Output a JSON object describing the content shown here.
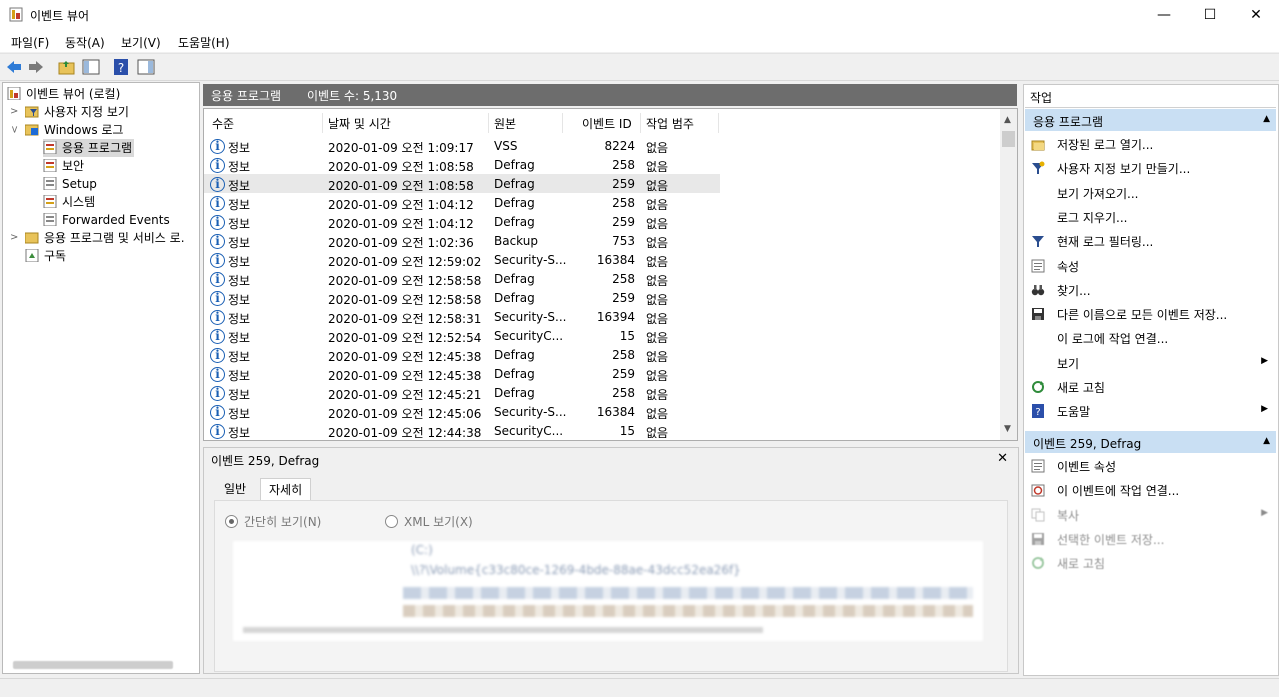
{
  "window": {
    "title": "이벤트 뷰어",
    "minimize": "—",
    "maximize": "☐",
    "close": "✕"
  },
  "menu": [
    "파일(F)",
    "동작(A)",
    "보기(V)",
    "도움말(H)"
  ],
  "tree": {
    "root": "이벤트 뷰어 (로컬)",
    "custom_views": "사용자 지정 보기",
    "windows_logs": "Windows 로그",
    "app_log": "응용 프로그램",
    "security": "보안",
    "setup": "Setup",
    "system": "시스템",
    "forwarded": "Forwarded Events",
    "app_services": "응용 프로그램 및 서비스 로.",
    "subscriptions": "구독"
  },
  "middle": {
    "header_title": "응용 프로그램",
    "event_count": "이벤트 수: 5,130"
  },
  "columns": {
    "level": "수준",
    "datetime": "날짜 및 시간",
    "source": "원본",
    "event_id": "이벤트 ID",
    "category": "작업 범주"
  },
  "events": [
    {
      "level": "정보",
      "datetime": "2020-01-09 오전 1:09:17",
      "source": "VSS",
      "id": "8224",
      "cat": "없음"
    },
    {
      "level": "정보",
      "datetime": "2020-01-09 오전 1:08:58",
      "source": "Defrag",
      "id": "258",
      "cat": "없음"
    },
    {
      "level": "정보",
      "datetime": "2020-01-09 오전 1:08:58",
      "source": "Defrag",
      "id": "259",
      "cat": "없음"
    },
    {
      "level": "정보",
      "datetime": "2020-01-09 오전 1:04:12",
      "source": "Defrag",
      "id": "258",
      "cat": "없음"
    },
    {
      "level": "정보",
      "datetime": "2020-01-09 오전 1:04:12",
      "source": "Defrag",
      "id": "259",
      "cat": "없음"
    },
    {
      "level": "정보",
      "datetime": "2020-01-09 오전 1:02:36",
      "source": "Backup",
      "id": "753",
      "cat": "없음"
    },
    {
      "level": "정보",
      "datetime": "2020-01-09 오전 12:59:02",
      "source": "Security-S...",
      "id": "16384",
      "cat": "없음"
    },
    {
      "level": "정보",
      "datetime": "2020-01-09 오전 12:58:58",
      "source": "Defrag",
      "id": "258",
      "cat": "없음"
    },
    {
      "level": "정보",
      "datetime": "2020-01-09 오전 12:58:58",
      "source": "Defrag",
      "id": "259",
      "cat": "없음"
    },
    {
      "level": "정보",
      "datetime": "2020-01-09 오전 12:58:31",
      "source": "Security-S...",
      "id": "16394",
      "cat": "없음"
    },
    {
      "level": "정보",
      "datetime": "2020-01-09 오전 12:52:54",
      "source": "SecurityC...",
      "id": "15",
      "cat": "없음"
    },
    {
      "level": "정보",
      "datetime": "2020-01-09 오전 12:45:38",
      "source": "Defrag",
      "id": "258",
      "cat": "없음"
    },
    {
      "level": "정보",
      "datetime": "2020-01-09 오전 12:45:38",
      "source": "Defrag",
      "id": "259",
      "cat": "없음"
    },
    {
      "level": "정보",
      "datetime": "2020-01-09 오전 12:45:21",
      "source": "Defrag",
      "id": "258",
      "cat": "없음"
    },
    {
      "level": "정보",
      "datetime": "2020-01-09 오전 12:45:06",
      "source": "Security-S...",
      "id": "16384",
      "cat": "없음"
    },
    {
      "level": "정보",
      "datetime": "2020-01-09 오전 12:44:38",
      "source": "SecurityC...",
      "id": "15",
      "cat": "없음"
    }
  ],
  "selected_row": 2,
  "details": {
    "title": "이벤트 259, Defrag",
    "close": "✕",
    "tab_general": "일반",
    "tab_detail": "자세히",
    "radio_simple": "간단히 보기(N)",
    "radio_xml": "XML 보기(X)",
    "xml_line1": "(C:)",
    "xml_line2": "\\\\?\\Volume{c33c80ce-1269-4bde-88ae-43dcc52ea26f}"
  },
  "actions": {
    "header": "작업",
    "section1": "응용 프로그램",
    "items1": [
      {
        "icon": "folder-open-icon",
        "label": "저장된 로그 열기..."
      },
      {
        "icon": "filter-create-icon",
        "label": "사용자 지정 보기 만들기..."
      },
      {
        "icon": "",
        "label": "보기 가져오기..."
      },
      {
        "icon": "",
        "label": "로그 지우기..."
      },
      {
        "icon": "filter-icon",
        "label": "현재 로그 필터링..."
      },
      {
        "icon": "properties-icon",
        "label": "속성"
      },
      {
        "icon": "binoculars-icon",
        "label": "찾기..."
      },
      {
        "icon": "save-icon",
        "label": "다른 이름으로 모든 이벤트 저장..."
      },
      {
        "icon": "",
        "label": "이 로그에 작업 연결..."
      },
      {
        "icon": "",
        "label": "보기",
        "submenu": true
      },
      {
        "icon": "refresh-icon",
        "label": "새로 고침"
      },
      {
        "icon": "help-icon",
        "label": "도움말",
        "submenu": true
      }
    ],
    "section2": "이벤트 259, Defrag",
    "items2": [
      {
        "icon": "properties-icon",
        "label": "이벤트 속성"
      },
      {
        "icon": "task-icon",
        "label": "이 이벤트에 작업 연결..."
      },
      {
        "icon": "copy-icon",
        "label": "복사",
        "submenu": true
      },
      {
        "icon": "save-icon",
        "label": "선택한 이벤트 저장..."
      },
      {
        "icon": "refresh-icon",
        "label": "새로 고침"
      }
    ]
  },
  "colors": {
    "section_bg": "#c9dff3",
    "header_bg": "#6d6d6d",
    "selected_row": "#e8e8e8",
    "info_icon": "#1a5fb4"
  }
}
